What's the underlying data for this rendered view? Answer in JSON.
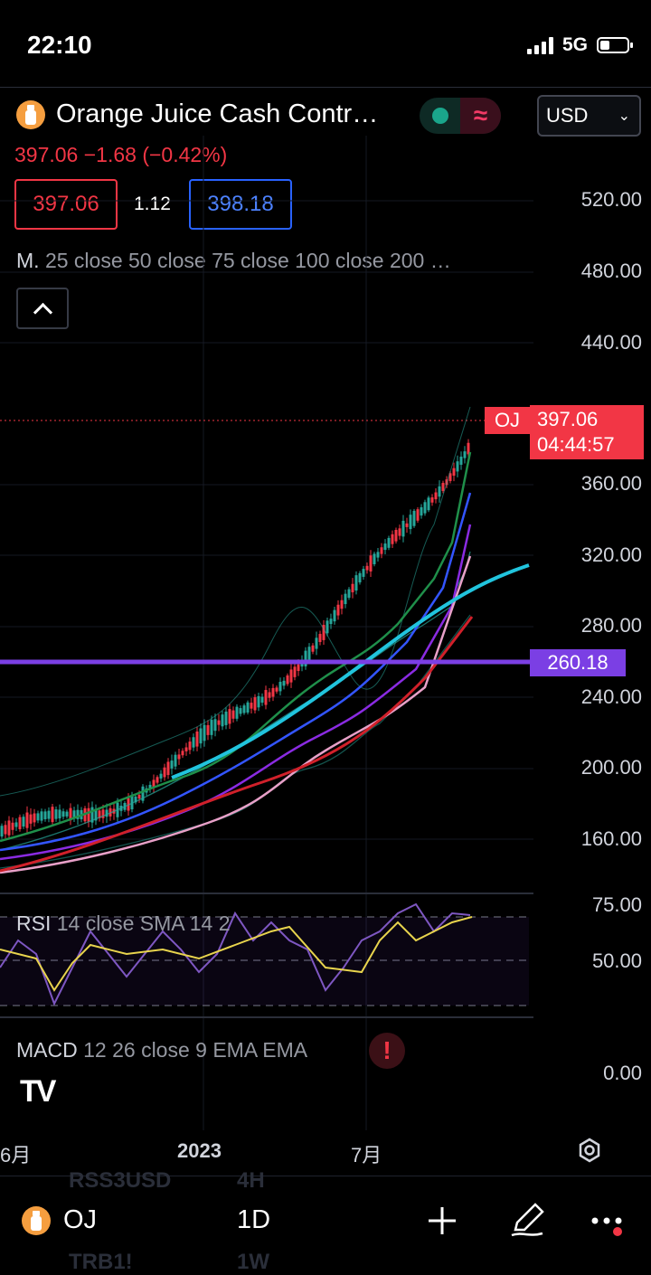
{
  "status": {
    "time": "22:10",
    "network": "5G"
  },
  "header": {
    "title": "Orange Juice Cash Contr…",
    "currency": "USD",
    "price_line": "397.06  −1.68  (−0.42%)",
    "bid": "397.06",
    "spread": "1.12",
    "ask": "398.18",
    "indicator_label": "M.",
    "indicator_params": "25 close 50 close 75 close 100 close 200 …"
  },
  "price_axis": [
    "520.00",
    "480.00",
    "440.00",
    "360.00",
    "320.00",
    "280.00",
    "240.00",
    "200.00",
    "160.00"
  ],
  "price_tags": {
    "symbol": "OJ",
    "last_price": "397.06",
    "countdown": "04:44:57",
    "horizontal_level": "260.18"
  },
  "rsi": {
    "label": "RSI",
    "params": "14 close SMA 14 2",
    "axis": [
      "75.00",
      "50.00"
    ]
  },
  "macd": {
    "label": "MACD",
    "params": "12 26 close 9 EMA EMA",
    "axis": "0.00"
  },
  "time_axis": [
    "6月",
    "2023",
    "7月"
  ],
  "bottom_nav": {
    "symbol": "OJ",
    "interval": "1D",
    "ghost_symbol_1": "RSS3USD",
    "ghost_interval_1": "4H",
    "ghost_symbol_2": "TRB1!",
    "ghost_interval_2": "1W"
  },
  "colors": {
    "up": "#26a69a",
    "down": "#f23645",
    "level": "#7b3fe4",
    "ask": "#2962ff",
    "accent_line": "#21c4dd"
  }
}
